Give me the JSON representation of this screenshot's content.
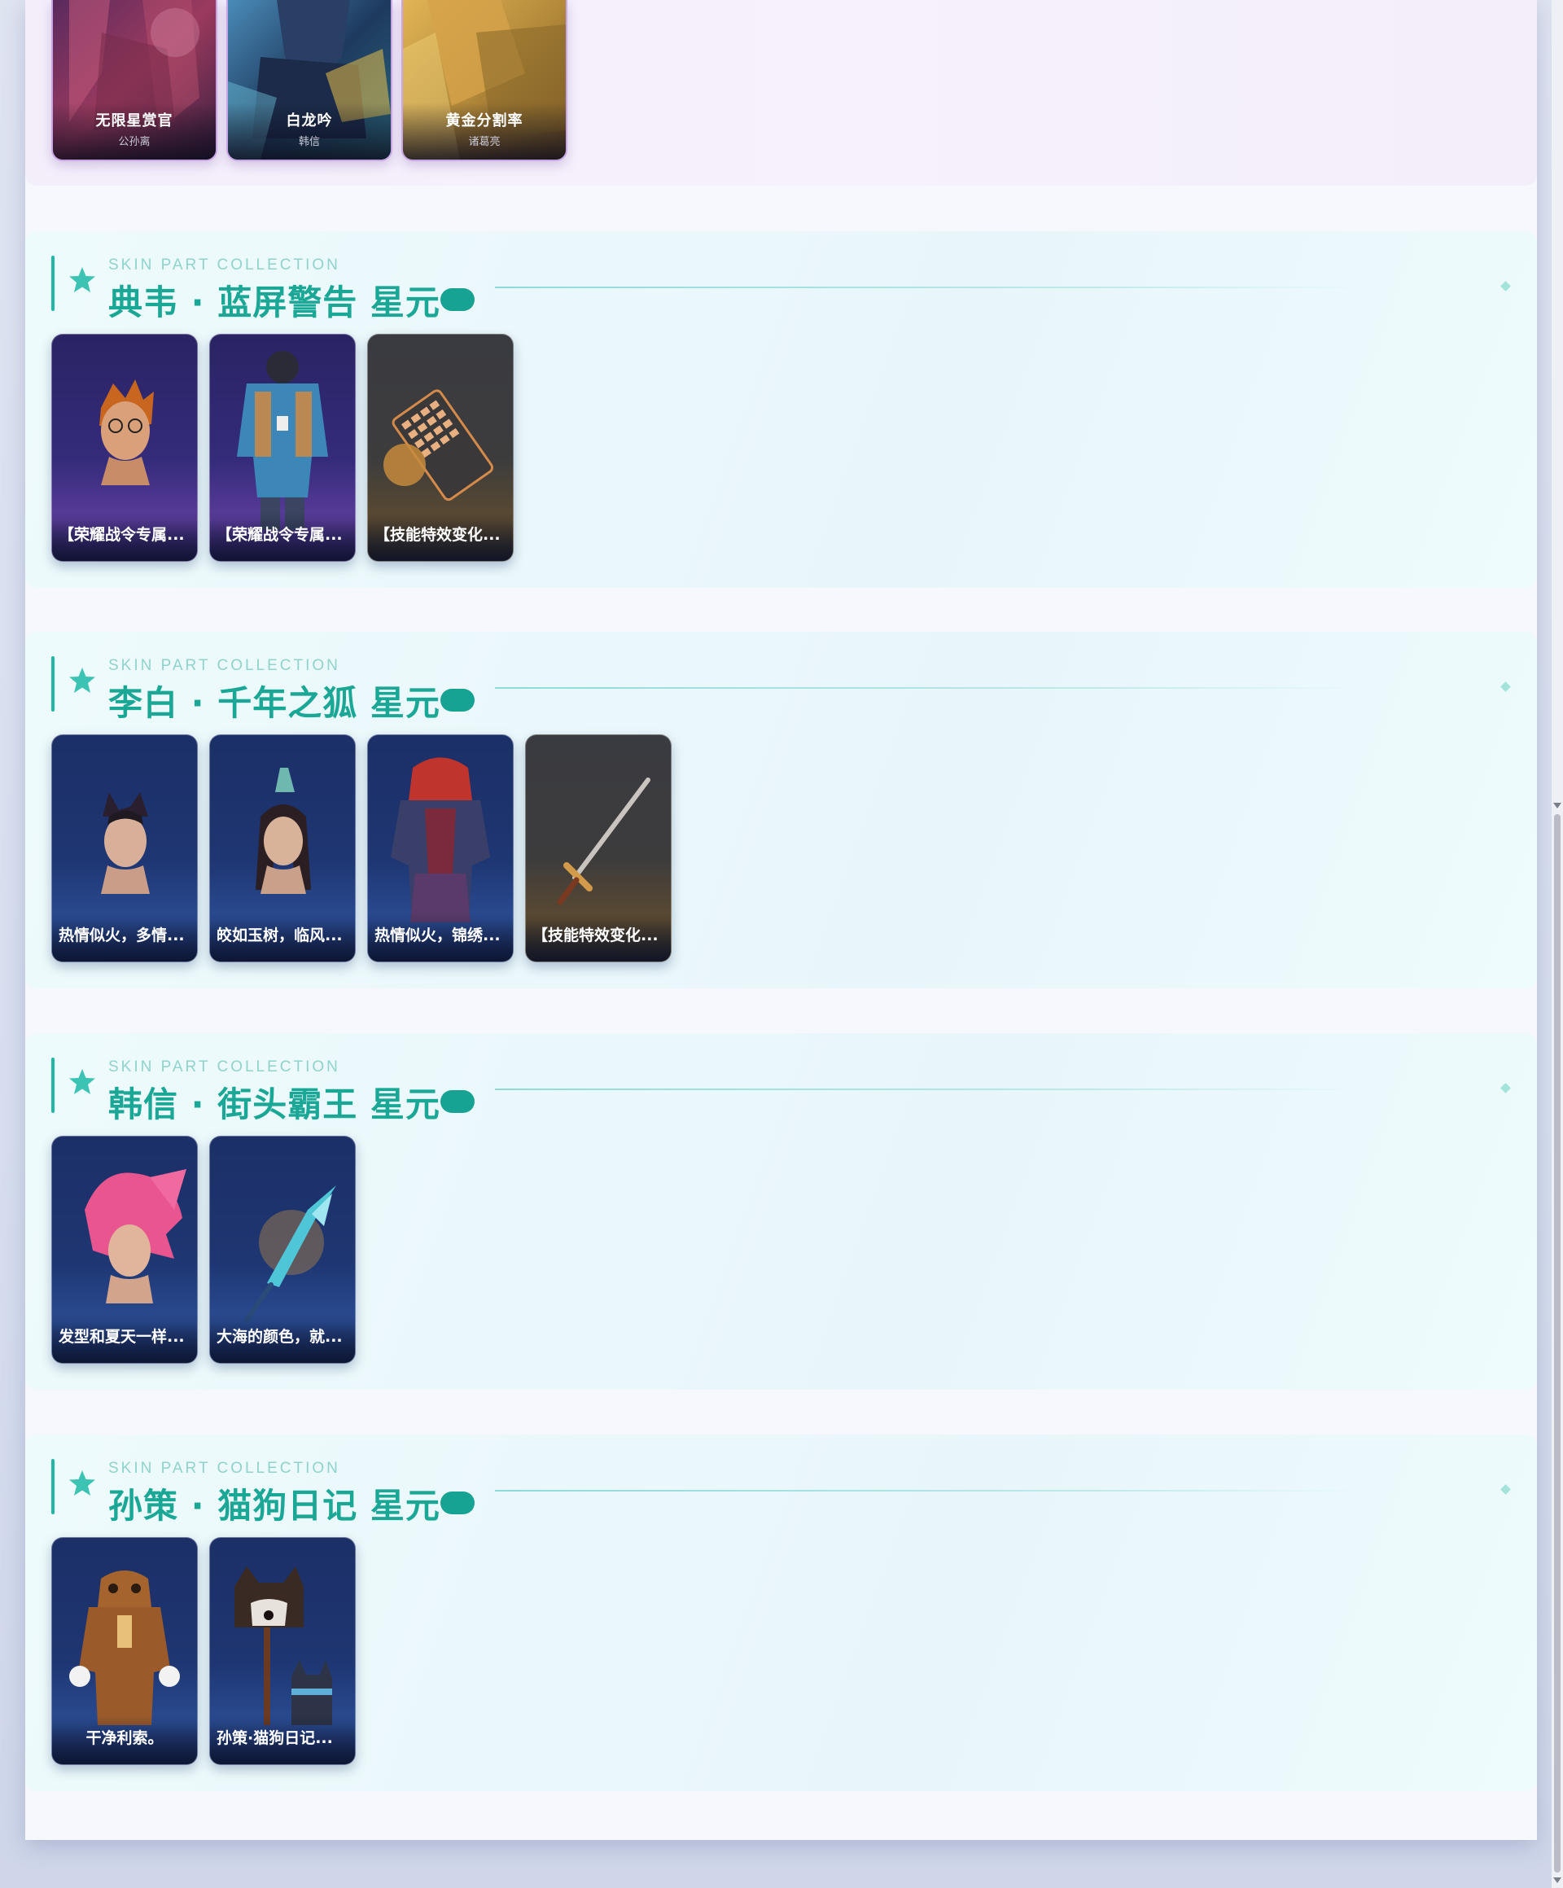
{
  "top_section": {
    "cards": [
      {
        "name": "无限星赏官",
        "hero": "公孙离",
        "color": "#9b3a5e"
      },
      {
        "name": "白龙吟",
        "hero": "韩信",
        "color": "#2a5f8f"
      },
      {
        "name": "黄金分割率",
        "hero": "诸葛亮",
        "color": "#b48a3a"
      }
    ]
  },
  "sections": [
    {
      "eyebrow": "SKIN PART COLLECTION",
      "title": "典韦 · 蓝屏警告 星元",
      "items": [
        {
          "caption": "【荣耀战令专属...",
          "theme": "purple",
          "icon": "hero-head-icon"
        },
        {
          "caption": "【荣耀战令专属...",
          "theme": "purple",
          "icon": "jacket-outfit-icon"
        },
        {
          "caption": "【技能特效变化...",
          "theme": "dark",
          "icon": "keyboard-weapon-icon"
        }
      ]
    },
    {
      "eyebrow": "SKIN PART COLLECTION",
      "title": "李白 · 千年之狐 星元",
      "items": [
        {
          "caption": "热情似火，多情...",
          "theme": "navy",
          "icon": "fox-head-icon"
        },
        {
          "caption": "皎如玉树，临风...",
          "theme": "navy",
          "icon": "hair-crown-icon"
        },
        {
          "caption": "热情似火，锦绣...",
          "theme": "navy",
          "icon": "armor-outfit-icon"
        },
        {
          "caption": "【技能特效变化...",
          "theme": "dark",
          "icon": "sword-icon"
        }
      ]
    },
    {
      "eyebrow": "SKIN PART COLLECTION",
      "title": "韩信 · 街头霸王 星元",
      "items": [
        {
          "caption": "发型和夏天一样...",
          "theme": "navy",
          "icon": "pink-hair-icon"
        },
        {
          "caption": "大海的颜色，就...",
          "theme": "navy",
          "icon": "spear-icon"
        }
      ]
    },
    {
      "eyebrow": "SKIN PART COLLECTION",
      "title": "孙策 · 猫狗日记 星元",
      "items": [
        {
          "caption": "干净利索。",
          "theme": "navy",
          "icon": "dog-suit-icon"
        },
        {
          "caption": "孙策·猫狗日记...",
          "theme": "navy",
          "icon": "dog-cat-icon"
        }
      ]
    }
  ],
  "colors": {
    "accent": "#1aa796",
    "accent_light": "#8fd3cc",
    "card_border": "#c9a6e6"
  }
}
